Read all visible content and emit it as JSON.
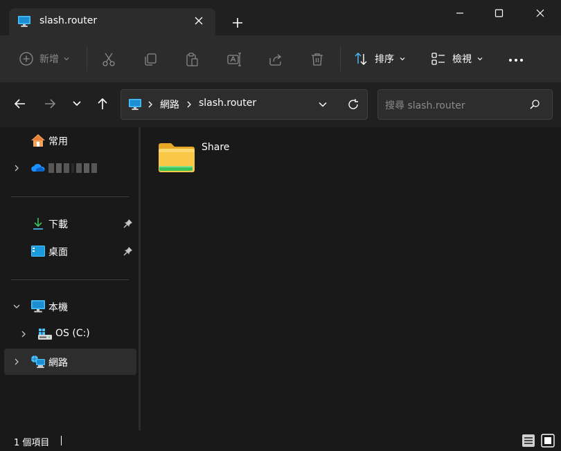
{
  "tab": {
    "title": "slash.router"
  },
  "toolbar": {
    "new_label": "新增",
    "sort_label": "排序",
    "view_label": "檢視"
  },
  "address": {
    "crumbs": [
      "網路",
      "slash.router"
    ]
  },
  "search": {
    "placeholder": "搜尋 slash.router"
  },
  "sidebar": {
    "items": [
      {
        "label": "常用",
        "icon": "home-icon"
      },
      {
        "label": "",
        "icon": "onedrive-cloud-icon",
        "redacted": true
      },
      {
        "label": "下載",
        "icon": "download-icon",
        "pinned": true
      },
      {
        "label": "桌面",
        "icon": "desktop-icon",
        "pinned": true
      },
      {
        "label": "本機",
        "icon": "this-pc-icon",
        "expanded": true
      },
      {
        "label": "OS (C:)",
        "icon": "drive-icon"
      },
      {
        "label": "網路",
        "icon": "network-icon",
        "selected": true
      }
    ]
  },
  "content": {
    "items": [
      {
        "name": "Share",
        "icon": "shared-folder-icon"
      }
    ]
  },
  "status": {
    "item_count": "1 個項目"
  },
  "colors": {
    "accent": "#4cc2ff",
    "folder": "#f9c846",
    "share_bar": "#3bc45b",
    "window_bg": "#191919",
    "toolbar_bg": "#2c2c2c"
  }
}
